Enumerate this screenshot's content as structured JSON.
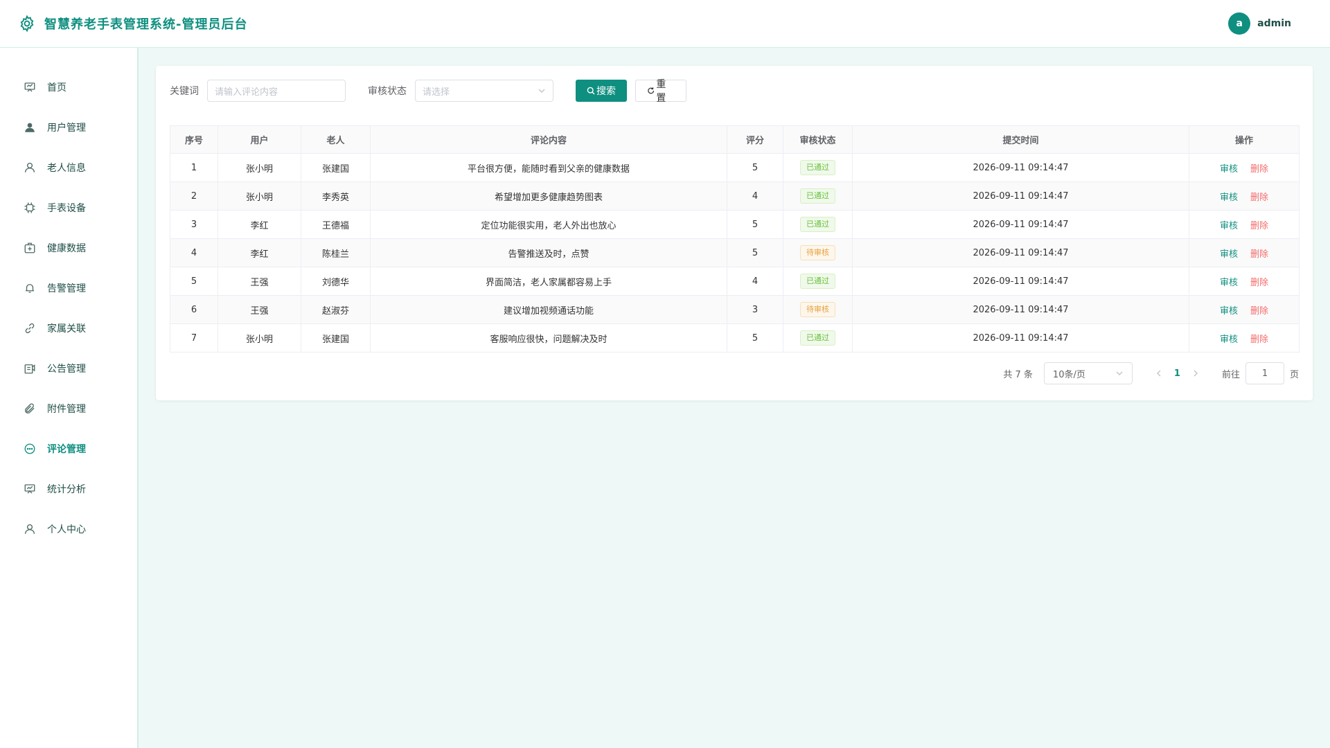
{
  "header": {
    "title": "智慧养老手表管理系统-管理员后台",
    "avatar_letter": "a",
    "username": "admin"
  },
  "sidebar": {
    "items": [
      {
        "label": "首页",
        "icon": "home-icon"
      },
      {
        "label": "用户管理",
        "icon": "user-icon"
      },
      {
        "label": "老人信息",
        "icon": "user-outline-icon"
      },
      {
        "label": "手表设备",
        "icon": "watch-chip-icon"
      },
      {
        "label": "健康数据",
        "icon": "first-aid-icon"
      },
      {
        "label": "告警管理",
        "icon": "bell-icon"
      },
      {
        "label": "家属关联",
        "icon": "link-icon"
      },
      {
        "label": "公告管理",
        "icon": "notice-icon"
      },
      {
        "label": "附件管理",
        "icon": "paperclip-icon"
      },
      {
        "label": "评论管理",
        "icon": "chat-icon",
        "active": true
      },
      {
        "label": "统计分析",
        "icon": "chart-icon"
      },
      {
        "label": "个人中心",
        "icon": "profile-icon"
      }
    ]
  },
  "filters": {
    "keyword_label": "关键词",
    "keyword_placeholder": "请输入评论内容",
    "status_label": "审核状态",
    "status_placeholder": "请选择",
    "search_label": "搜索",
    "reset_label": "重置"
  },
  "table": {
    "columns": [
      "序号",
      "用户",
      "老人",
      "评论内容",
      "评分",
      "审核状态",
      "提交时间",
      "操作"
    ],
    "rows": [
      {
        "no": "1",
        "user": "张小明",
        "elder": "张建国",
        "content": "平台很方便，能随时看到父亲的健康数据",
        "score": "5",
        "status": "已通过",
        "time": "2026-09-11 09:14:47"
      },
      {
        "no": "2",
        "user": "张小明",
        "elder": "李秀英",
        "content": "希望增加更多健康趋势图表",
        "score": "4",
        "status": "已通过",
        "time": "2026-09-11 09:14:47"
      },
      {
        "no": "3",
        "user": "李红",
        "elder": "王德福",
        "content": "定位功能很实用，老人外出也放心",
        "score": "5",
        "status": "已通过",
        "time": "2026-09-11 09:14:47"
      },
      {
        "no": "4",
        "user": "李红",
        "elder": "陈桂兰",
        "content": "告警推送及时，点赞",
        "score": "5",
        "status": "待审核",
        "time": "2026-09-11 09:14:47"
      },
      {
        "no": "5",
        "user": "王强",
        "elder": "刘德华",
        "content": "界面简洁，老人家属都容易上手",
        "score": "4",
        "status": "已通过",
        "time": "2026-09-11 09:14:47"
      },
      {
        "no": "6",
        "user": "王强",
        "elder": "赵淑芬",
        "content": "建议增加视频通话功能",
        "score": "3",
        "status": "待审核",
        "time": "2026-09-11 09:14:47"
      },
      {
        "no": "7",
        "user": "张小明",
        "elder": "张建国",
        "content": "客服响应很快，问题解决及时",
        "score": "5",
        "status": "已通过",
        "time": "2026-09-11 09:14:47"
      }
    ],
    "op_audit": "审核",
    "op_delete": "删除"
  },
  "pagination": {
    "total_text": "共 7 条",
    "page_size": "10条/页",
    "current_page": "1",
    "goto_label": "前往",
    "goto_value": "1",
    "page_suffix": "页"
  },
  "colors": {
    "primary": "#0f8f80",
    "approved": "#67c23a",
    "pending": "#e6a23c",
    "danger": "#f56c6c"
  }
}
